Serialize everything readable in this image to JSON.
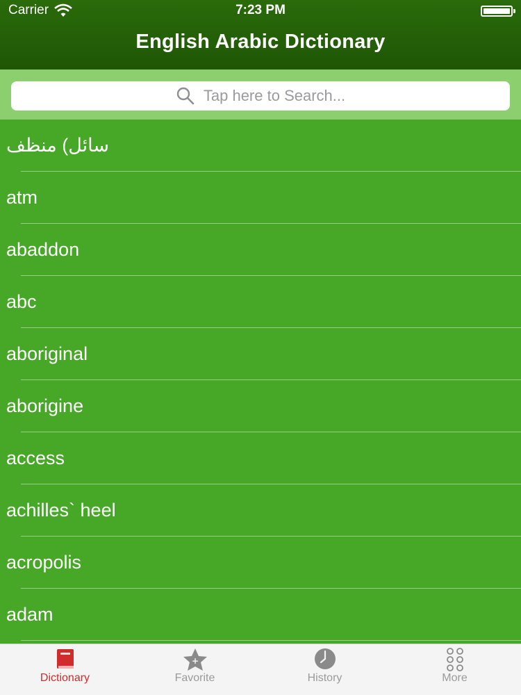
{
  "status_bar": {
    "carrier": "Carrier",
    "time": "7:23 PM"
  },
  "header": {
    "title": "English Arabic Dictionary"
  },
  "search": {
    "placeholder": "Tap here to Search..."
  },
  "words": [
    "سائل) منظف",
    "atm",
    "abaddon",
    "abc",
    "aboriginal",
    "aborigine",
    "access",
    "achilles` heel",
    "acropolis",
    "adam"
  ],
  "tabs": [
    {
      "label": "Dictionary",
      "icon": "book-icon",
      "active": true
    },
    {
      "label": "Favorite",
      "icon": "star-icon",
      "active": false
    },
    {
      "label": "History",
      "icon": "clock-icon",
      "active": false
    },
    {
      "label": "More",
      "icon": "more-dots-icon",
      "active": false
    }
  ],
  "colors": {
    "header": "#2a6b0a",
    "list_background": "#47a827",
    "search_background": "#8ccf6f",
    "active_tab": "#d12c2c",
    "inactive_tab": "#9a9a9a"
  }
}
